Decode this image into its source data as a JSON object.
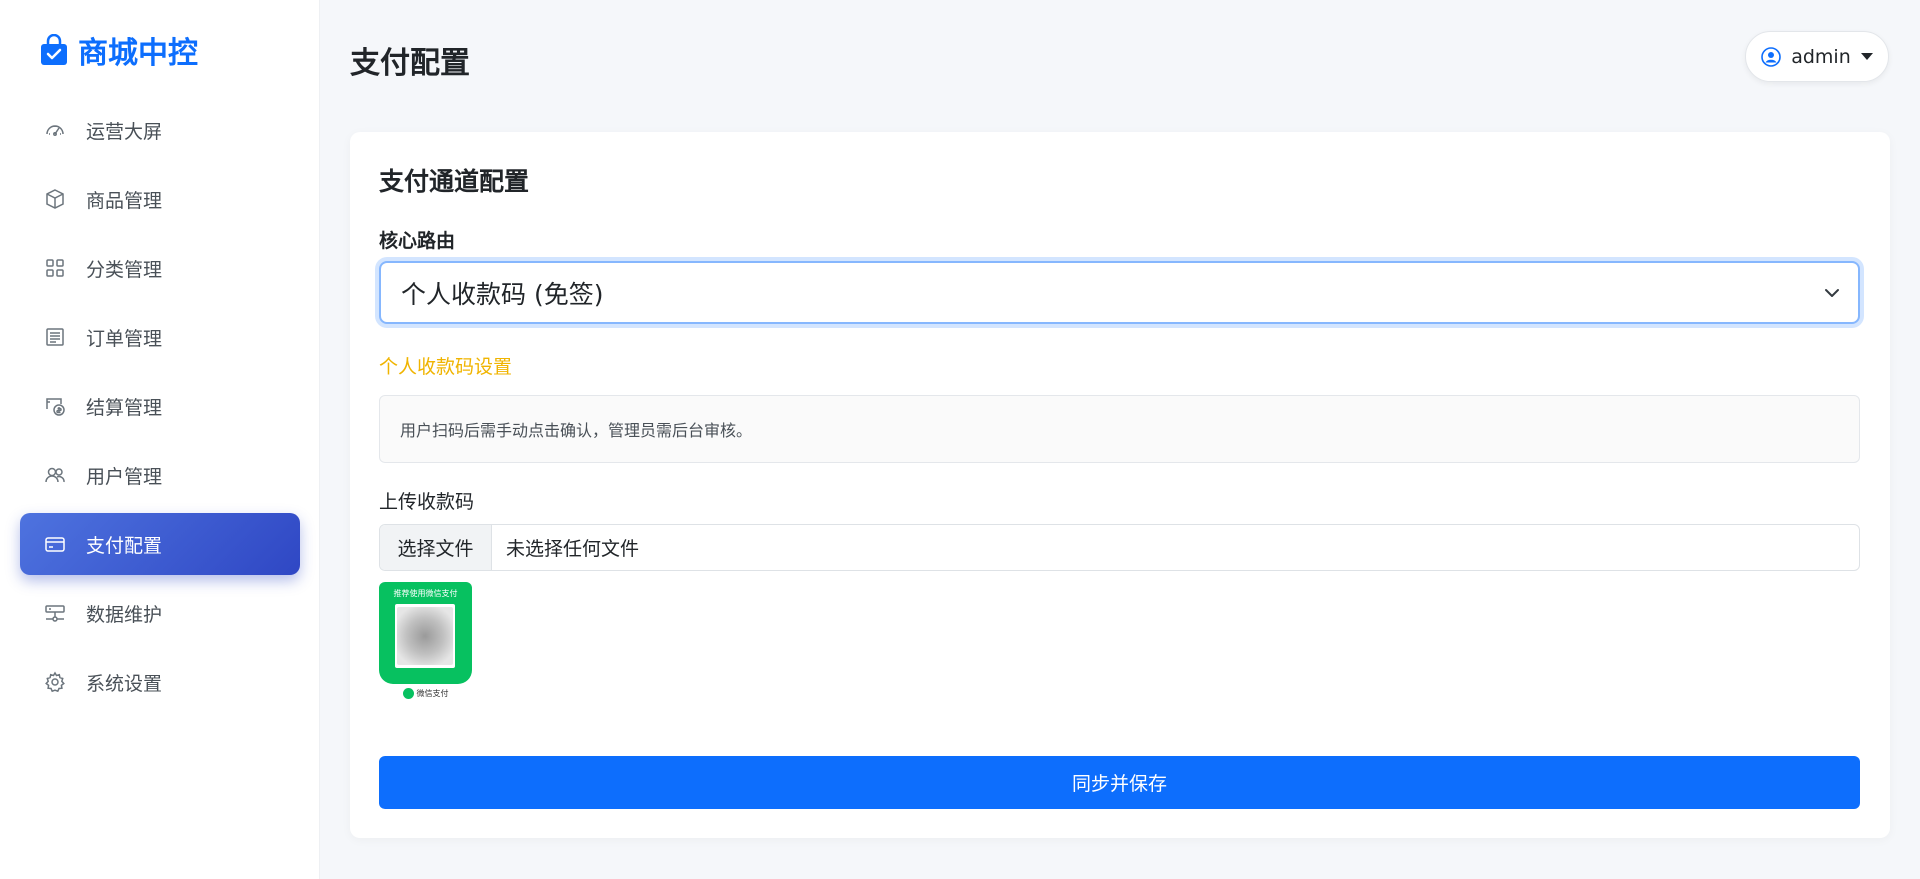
{
  "app": {
    "brand": "商城中控",
    "brand_color": "#0d6efd"
  },
  "sidebar": {
    "items": [
      {
        "label": "运营大屏",
        "icon": "speedometer-icon",
        "active": false
      },
      {
        "label": "商品管理",
        "icon": "box-icon",
        "active": false
      },
      {
        "label": "分类管理",
        "icon": "grid-icon",
        "active": false
      },
      {
        "label": "订单管理",
        "icon": "document-list-icon",
        "active": false
      },
      {
        "label": "结算管理",
        "icon": "cash-settlement-icon",
        "active": false
      },
      {
        "label": "用户管理",
        "icon": "users-icon",
        "active": false
      },
      {
        "label": "支付配置",
        "icon": "credit-card-icon",
        "active": true
      },
      {
        "label": "数据维护",
        "icon": "hdd-network-icon",
        "active": false
      },
      {
        "label": "系统设置",
        "icon": "gear-icon",
        "active": false
      }
    ]
  },
  "header": {
    "title": "支付配置",
    "user": "admin",
    "user_icon": "user-circle-icon"
  },
  "card": {
    "title": "支付通道配置",
    "core_route_label": "核心路由",
    "core_route_selected": "个人收款码 (免签)",
    "section_title": "个人收款码设置",
    "section_title_color": "#f0b400",
    "info_text": "用户扫码后需手动点击确认，管理员需后台审核。",
    "upload_label": "上传收款码",
    "file_button": "选择文件",
    "file_status": "未选择任何文件",
    "qr_preview": {
      "header_text": "推荐使用微信支付",
      "footer_text": "微信支付",
      "color": "#07c160"
    },
    "save_button": "同步并保存"
  }
}
